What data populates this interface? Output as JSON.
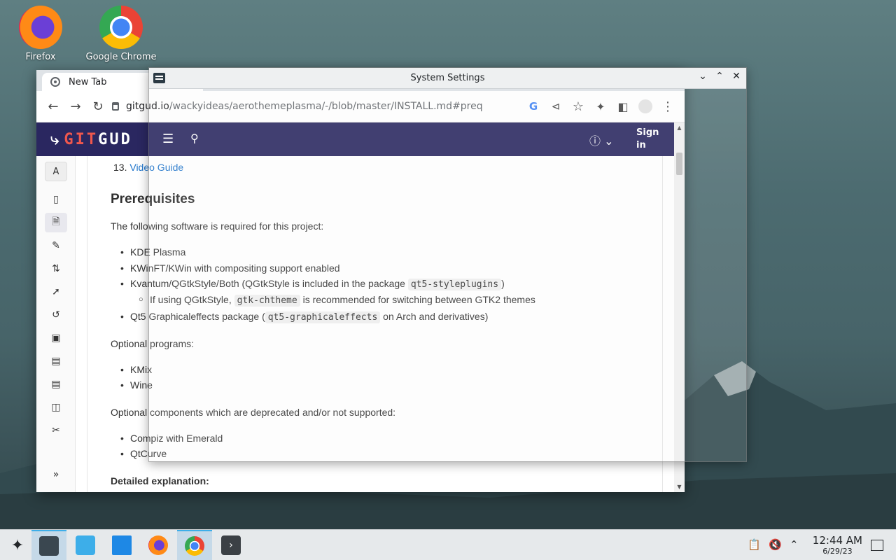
{
  "desktop": {
    "icons": [
      {
        "label": "Firefox"
      },
      {
        "label": "Google Chrome"
      }
    ]
  },
  "chrome": {
    "tab_title": "New Tab",
    "url_host": "gitgud.io",
    "url_path": "/wackyideas/aerothemeplasma/-/blob/master/INSTALL.md#preq"
  },
  "gitgud": {
    "logo_git": "GIT",
    "logo_gud": "GUD",
    "sign_in": "Sign in",
    "sidebar_avatar": "A"
  },
  "document": {
    "item13_number": "13.",
    "item13_link": "Video Guide",
    "heading": "Prerequisites",
    "intro": "The following software is required for this project:",
    "req1": "KDE Plasma",
    "req2": "KWinFT/KWin with compositing support enabled",
    "req3_pre": "Kvantum/QGtkStyle/Both (QGtkStyle is included in the package ",
    "req3_code": "qt5-styleplugins",
    "req3_post": ")",
    "req3_sub_pre": "If using QGtkStyle, ",
    "req3_sub_code": "gtk-chtheme",
    "req3_sub_post": " is recommended for switching between GTK2 themes",
    "req4_pre": "Qt5 Graphicaleffects package (",
    "req4_code": "qt5-graphicaleffects",
    "req4_post": " on Arch and derivatives)",
    "optional_heading": "Optional programs:",
    "opt1": "KMix",
    "opt2": "Wine",
    "deprecated_heading": "Optional components which are deprecated and/or not supported:",
    "dep1": "Compiz with Emerald",
    "dep2": "QtCurve",
    "detailed": "Detailed explanation:"
  },
  "settings": {
    "title": "System Settings"
  },
  "taskbar": {
    "time": "12:44 AM",
    "date": "6/29/23"
  },
  "colors": {
    "gitgud_bar": "#2a2760",
    "link": "#1f75cb",
    "accent": "#3daee9"
  }
}
